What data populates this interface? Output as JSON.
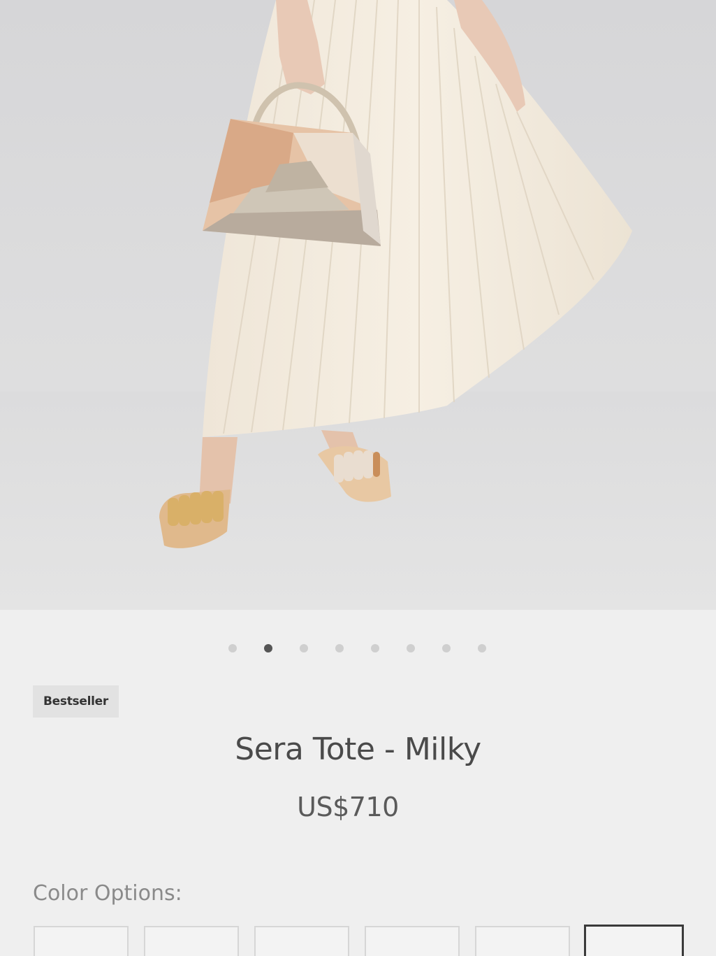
{
  "hero": {
    "image": "product-photo-pleated-skirt-with-tote",
    "background_color": "#d9d9db"
  },
  "carousel": {
    "count": 8,
    "active_index": 1
  },
  "product": {
    "badge": "Bestseller",
    "title": "Sera Tote - Milky",
    "price": "US$710"
  },
  "color_options": {
    "label": "Color Options:",
    "swatch_count": 6,
    "selected_index": 5
  },
  "colors": {
    "text_primary": "#4a4a4a",
    "text_secondary": "#8a8a8a",
    "dot_active": "#555555",
    "dot_inactive": "#cfcfcf",
    "badge_bg": "#e2e2e2"
  }
}
